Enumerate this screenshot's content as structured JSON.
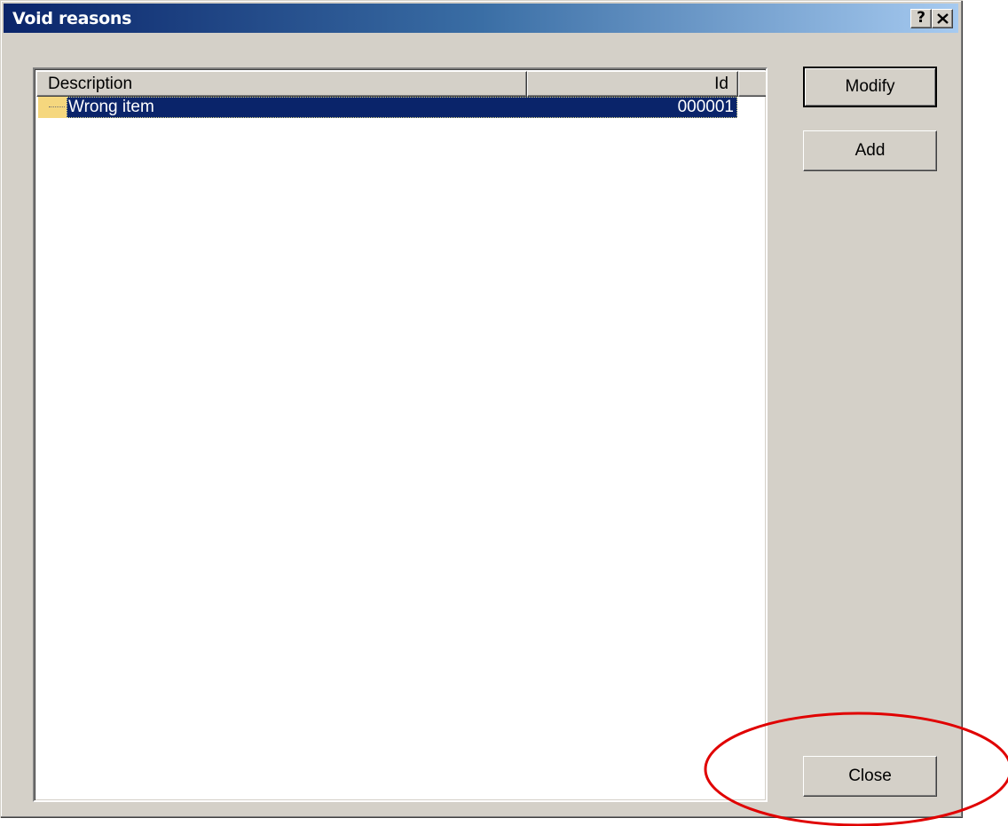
{
  "window": {
    "title": "Void reasons",
    "help_button_label": "?",
    "close_icon": "close-icon"
  },
  "list": {
    "columns": [
      "Description",
      "Id",
      ""
    ],
    "rows": [
      {
        "description": "Wrong item",
        "id": "000001",
        "selected": true
      }
    ]
  },
  "buttons": {
    "modify": "Modify",
    "add": "Add",
    "close": "Close"
  },
  "colors": {
    "title_gradient_start": "#0a246a",
    "title_gradient_end": "#a6caf0",
    "selection": "#0a246a",
    "annotation_ring": "#e00000"
  }
}
